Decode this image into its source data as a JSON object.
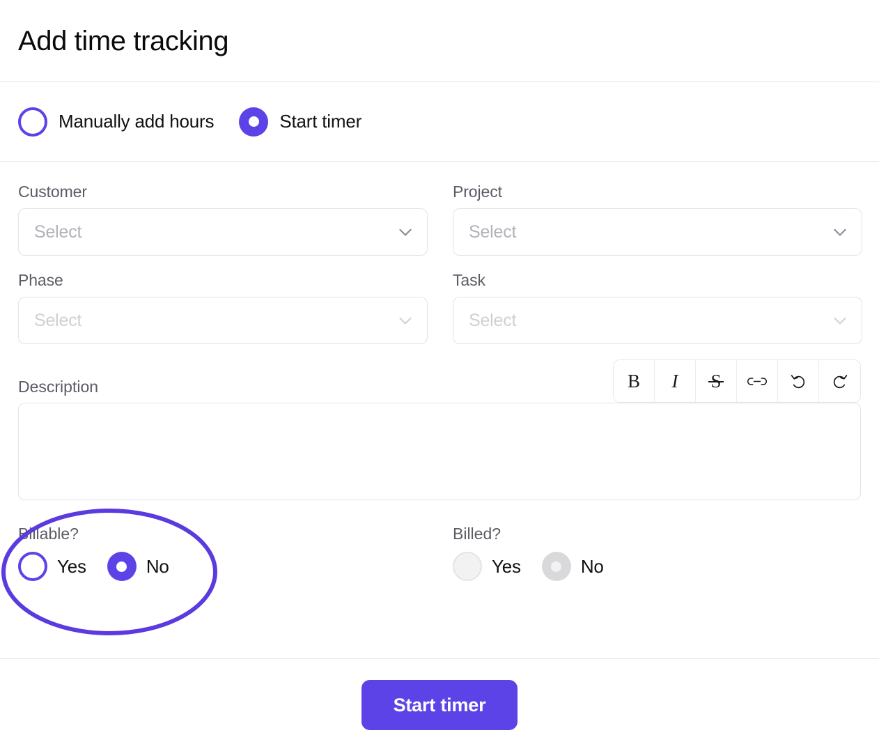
{
  "header": {
    "title": "Add time tracking"
  },
  "mode": {
    "options": [
      {
        "label": "Manually add hours",
        "state": "unchecked"
      },
      {
        "label": "Start timer",
        "state": "checked"
      }
    ]
  },
  "form": {
    "customer": {
      "label": "Customer",
      "value": "Select",
      "placeholder": "Select",
      "disabled": false
    },
    "project": {
      "label": "Project",
      "value": "Select",
      "placeholder": "Select",
      "disabled": false
    },
    "phase": {
      "label": "Phase",
      "value": "Select",
      "placeholder": "Select",
      "disabled": true
    },
    "task": {
      "label": "Task",
      "value": "Select",
      "placeholder": "Select",
      "disabled": true
    },
    "description": {
      "label": "Description",
      "value": "",
      "toolbar": [
        {
          "name": "bold-icon",
          "glyph": "B",
          "title": "Bold"
        },
        {
          "name": "italic-icon",
          "glyph": "I",
          "title": "Italic"
        },
        {
          "name": "strikethrough-icon",
          "glyph": "S",
          "title": "Strikethrough"
        },
        {
          "name": "link-icon",
          "glyph": "",
          "title": "Link"
        },
        {
          "name": "undo-icon",
          "glyph": "",
          "title": "Undo"
        },
        {
          "name": "redo-icon",
          "glyph": "",
          "title": "Redo"
        }
      ]
    }
  },
  "toggles": {
    "billable": {
      "label": "Billable?",
      "yes": "Yes",
      "no": "No",
      "selected": "No",
      "disabled": false
    },
    "billed": {
      "label": "Billed?",
      "yes": "Yes",
      "no": "No",
      "selected": "No",
      "disabled": true
    }
  },
  "annotation": {
    "shape": "ellipse",
    "targets": "billable-toggle-group",
    "color": "#5b3be0"
  },
  "footer": {
    "submit_label": "Start timer"
  },
  "colors": {
    "accent": "#5b43e8",
    "annotation": "#5b3be0",
    "label": "#5b5b66",
    "placeholder": "#b2b2ba",
    "border": "#e2e2e6",
    "divider": "#e7e7ea"
  }
}
